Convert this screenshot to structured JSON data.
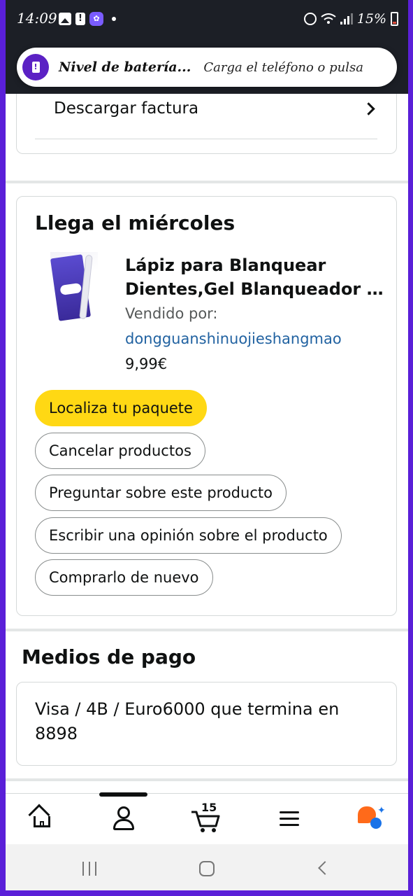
{
  "status_bar": {
    "time": "14:09",
    "battery_pct": "15%",
    "app_badge": "✿"
  },
  "notification": {
    "title": "Nivel de batería...",
    "text": "Carga el teléfono o pulsa"
  },
  "invoice": {
    "download_label": "Descargar factura"
  },
  "delivery": {
    "heading": "Llega el miércoles",
    "product": {
      "title_line1": "Lápiz para Blanquear",
      "title_line2": "Dientes,Gel Blanqueador Dental",
      "sold_by_label": "Vendido por:",
      "seller": "dongguanshinuojieshangmao",
      "price": "9,99€"
    },
    "buttons": {
      "track": "Localiza tu paquete",
      "cancel": "Cancelar productos",
      "ask": "Preguntar sobre este producto",
      "review": "Escribir una opinión sobre el producto",
      "buy_again": "Comprarlo de nuevo"
    }
  },
  "payment": {
    "heading": "Medios de pago",
    "method": "Visa / 4B / Euro6000 que termina en 8898"
  },
  "bottom_nav": {
    "cart_count": "15",
    "items": [
      "home",
      "account",
      "cart",
      "menu",
      "rufus-ai"
    ]
  },
  "colors": {
    "primary_button": "#ffd814",
    "link": "#2162a1",
    "frame": "#5a1fd8"
  }
}
